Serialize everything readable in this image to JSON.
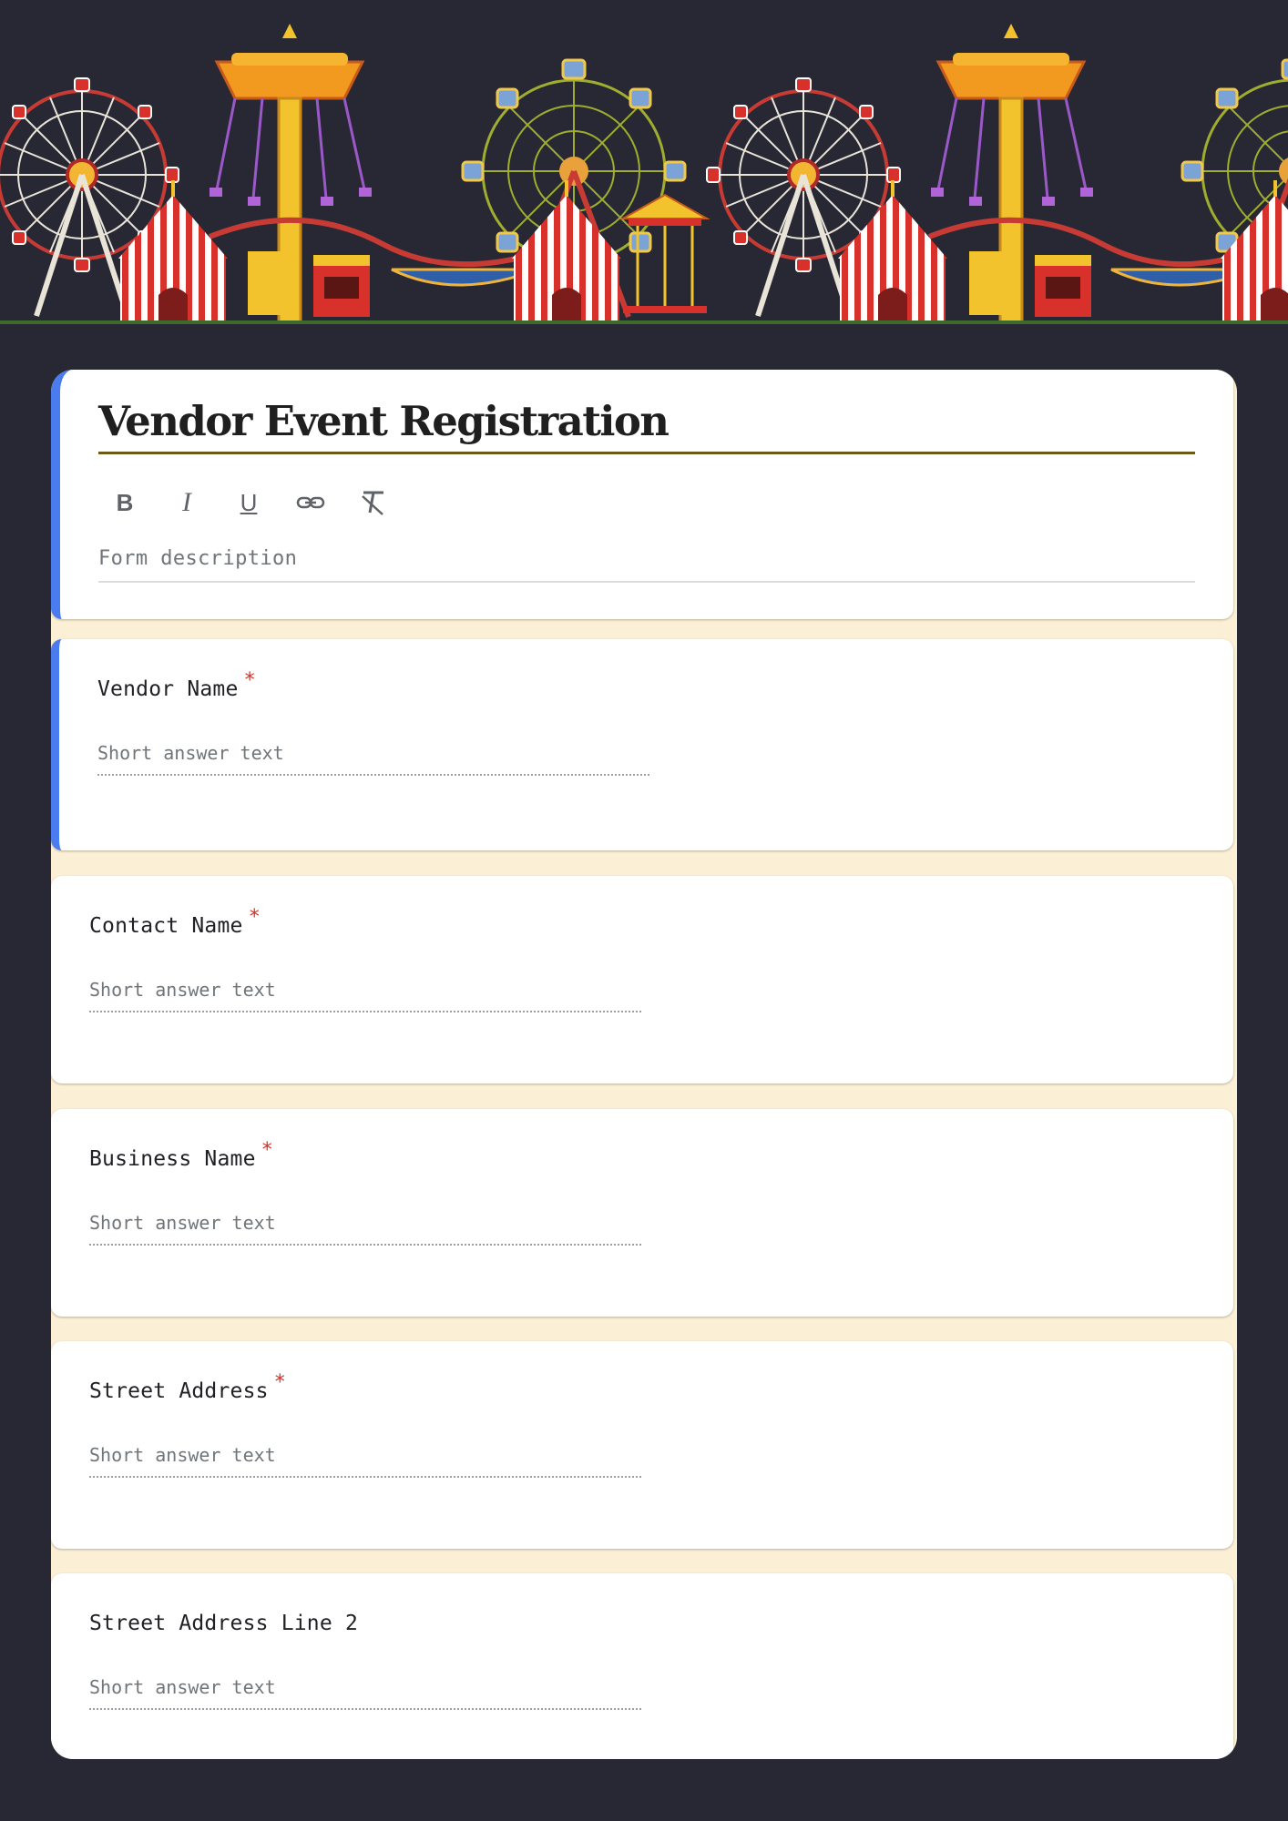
{
  "form": {
    "title": "Vendor Event Registration",
    "description_placeholder": "Form description",
    "toolbar": [
      {
        "name": "bold",
        "glyph": "B"
      },
      {
        "name": "italic",
        "glyph": "I"
      },
      {
        "name": "underline",
        "glyph": "U"
      },
      {
        "name": "link",
        "glyph": "link-icon"
      },
      {
        "name": "clear-format",
        "glyph": "clear-format-icon"
      }
    ]
  },
  "questions": [
    {
      "label": "Vendor Name",
      "required": "*",
      "placeholder": "Short answer text"
    },
    {
      "label": "Contact Name",
      "required": "*",
      "placeholder": "Short answer text"
    },
    {
      "label": "Business Name",
      "required": "*",
      "placeholder": "Short answer text"
    },
    {
      "label": "Street Address",
      "required": "*",
      "placeholder": "Short answer text"
    },
    {
      "label": "Street Address Line 2",
      "required": "",
      "placeholder": "Short answer text"
    }
  ],
  "colors": {
    "page_background": "#272834",
    "form_background": "#fbf0d6",
    "accent": "#4a7cf0",
    "title_underline": "#6b5a19",
    "required": "#d93025"
  },
  "banner": {
    "theme": "carnival-ferris-wheels-rides-tents"
  }
}
